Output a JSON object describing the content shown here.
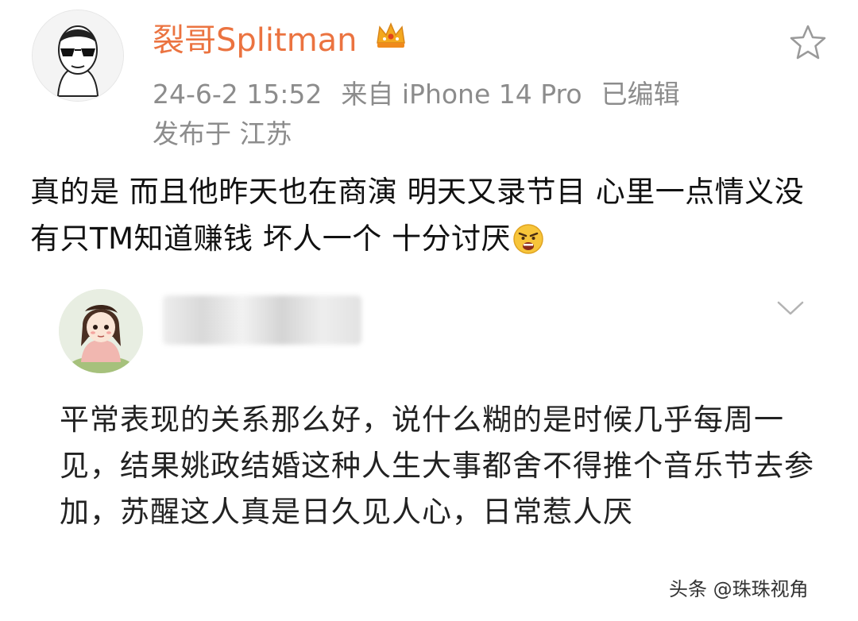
{
  "post": {
    "username": "裂哥Splitman",
    "timestamp": "24-6-2 15:52",
    "source": "来自 iPhone 14 Pro",
    "edited": "已编辑",
    "location": "发布于 江苏",
    "text": "真的是 而且他昨天也在商演 明天又录节目 心里一点情义没有只TM知道赚钱 坏人一个 十分讨厌",
    "icons": {
      "avatar": "avatar-man-sunglasses",
      "badge": "crown-icon",
      "favorite": "star-icon",
      "emoji": "angry-emoji-icon"
    },
    "colors": {
      "username": "#eb7340",
      "meta": "#8c8c8c"
    }
  },
  "comment": {
    "text": "平常表现的关系那么好，说什么糊的是时候几乎每周一见，结果姚政结婚这种人生大事都舍不得推个音乐节去参加，苏醒这人真是日久见人心，日常惹人厌",
    "icons": {
      "avatar": "avatar-girl",
      "more": "chevron-down-icon"
    }
  },
  "watermark": "头条 @珠珠视角"
}
